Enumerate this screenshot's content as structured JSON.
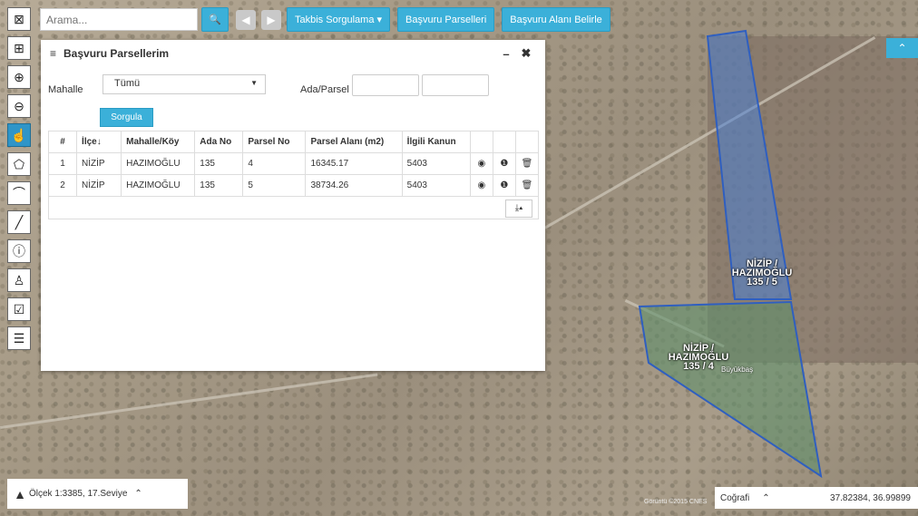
{
  "search": {
    "placeholder": "Arama...",
    "icon": "search-icon"
  },
  "topbar": {
    "takbis_label": "Takbis Sorgulama",
    "parcels_label": "Başvuru Parselleri",
    "area_label": "Başvuru Alanı Belirle"
  },
  "toolbar": {
    "icons": [
      "layers-icon",
      "grid-icon",
      "zoom-in-icon",
      "zoom-out-icon",
      "hand-pointer-icon",
      "polygon-icon",
      "curve-icon",
      "line-icon",
      "info-icon",
      "location-person-icon",
      "clipboard-check-icon",
      "document-list-icon"
    ]
  },
  "panel": {
    "title": "Başvuru Parsellerim",
    "minimize": "–",
    "close": "✖",
    "mahalle_label": "Mahalle",
    "mahalle_value": "Tümü",
    "ada_parsel_label": "Ada/Parsel",
    "query_button": "Sorgula"
  },
  "table": {
    "headers": [
      "#",
      "İlçe↓",
      "Mahalle/Köy",
      "Ada No",
      "Parsel No",
      "Parsel Alanı (m2)",
      "İlgili Kanun",
      "",
      "",
      ""
    ],
    "rows": [
      [
        "1",
        "NİZİP",
        "HAZIMOĞLU",
        "135",
        "4",
        "16345.17",
        "5403"
      ],
      [
        "2",
        "NİZİP",
        "HAZIMOĞLU",
        "135",
        "5",
        "38734.26",
        "5403"
      ]
    ]
  },
  "map": {
    "parcel_5_label_line1": "NİZİP / HAZIMOĞLU",
    "parcel_5_label_line2": "135 / 5",
    "parcel_4_label_line1": "NİZİP / HAZIMOĞLU",
    "parcel_4_label_line2": "135 / 4",
    "buyukbas_label": "Büyükbaş",
    "attribution": "Görüntü ©2015 CNES"
  },
  "scale": {
    "text": "Ölçek 1:3385, 17.Seviye"
  },
  "coords": {
    "projection": "Coğrafi",
    "value": "37.82384, 36.99899"
  },
  "colors": {
    "accent": "#3bb0d9",
    "parcel_blue": "#4a7fd4",
    "parcel_green": "#5f8f6a"
  }
}
